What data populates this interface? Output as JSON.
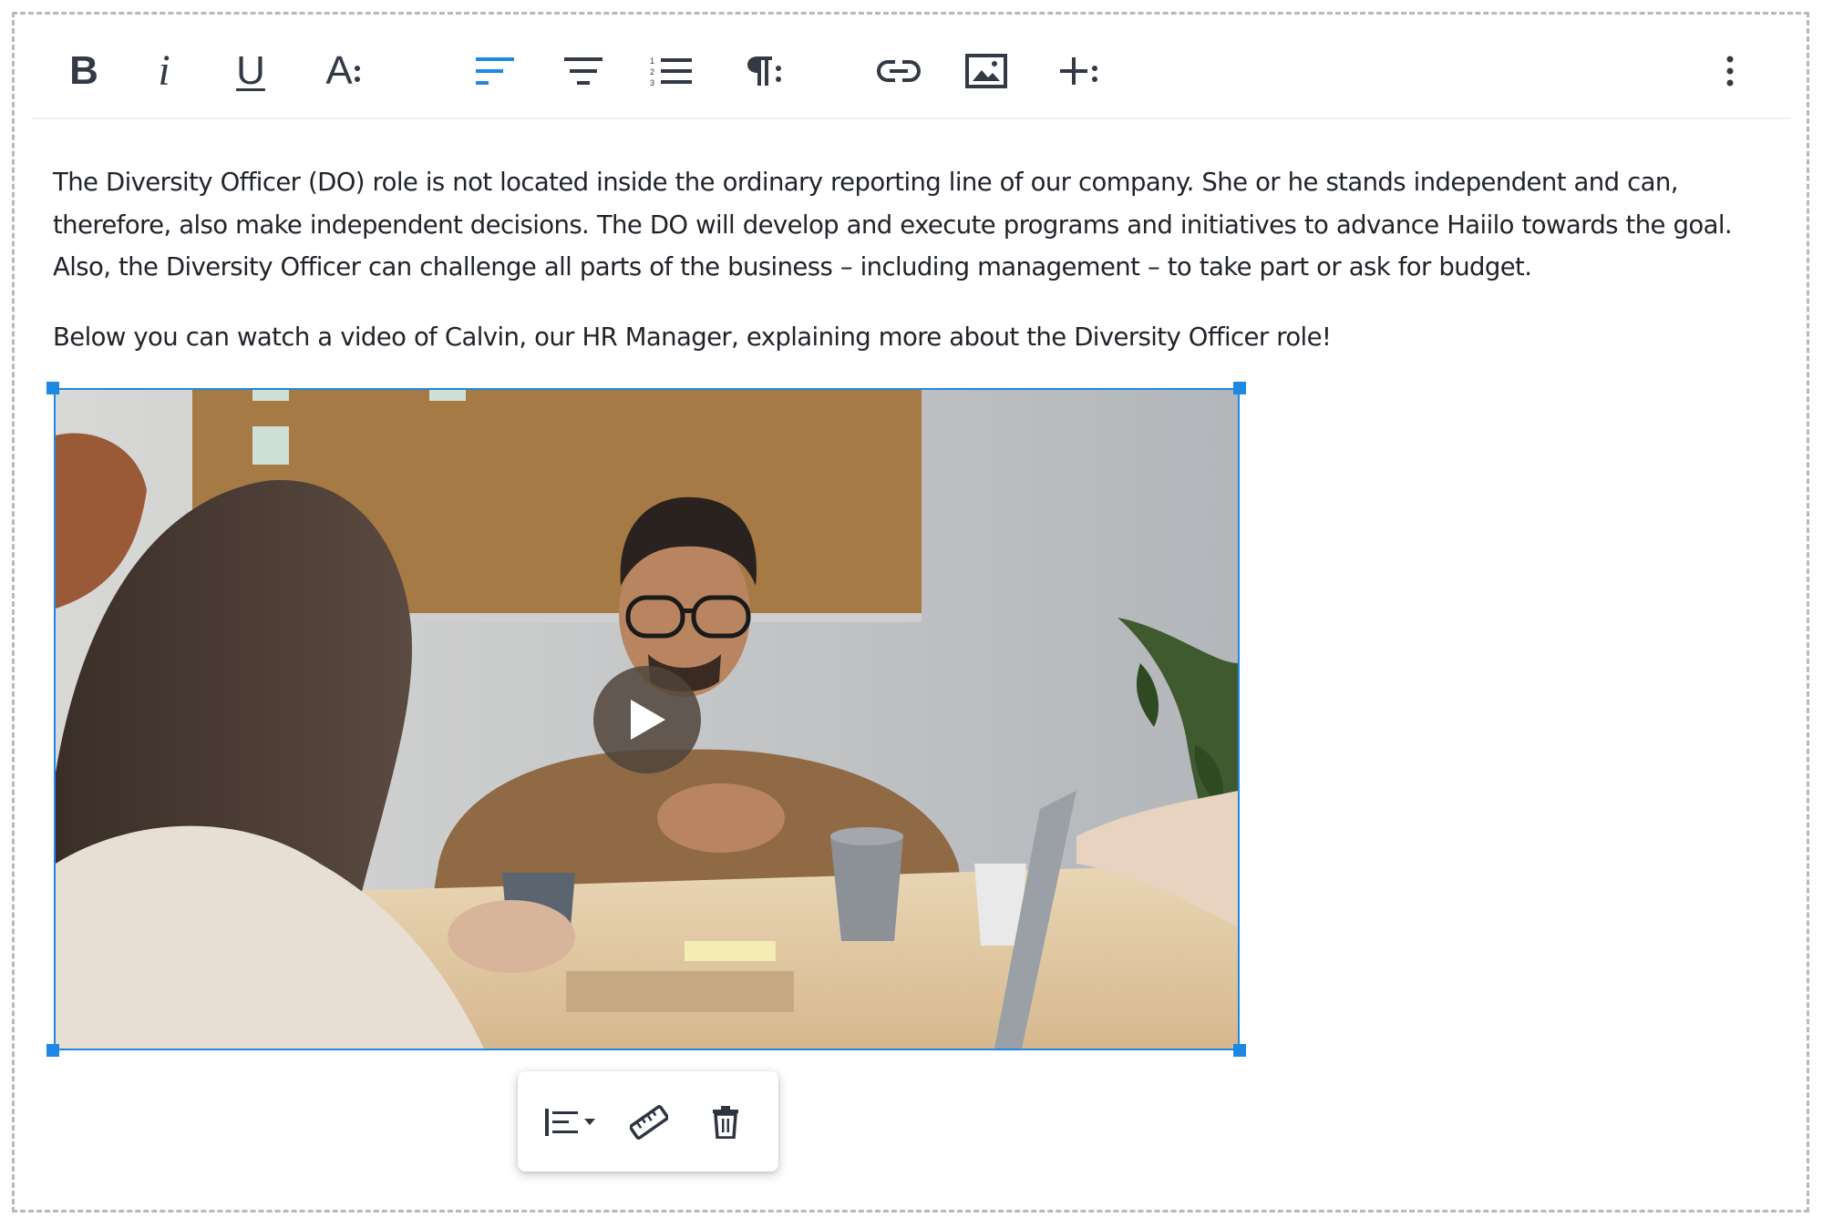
{
  "toolbar": {
    "bold_label": "B",
    "italic_label": "i",
    "underline_label": "U",
    "font_label": "A",
    "accent_color": "#1e88e5",
    "icon_color": "#2e3440",
    "icons": [
      "bold-icon",
      "italic-icon",
      "underline-icon",
      "font-options-icon",
      "align-left-icon",
      "align-center-icon",
      "ordered-list-icon",
      "paragraph-options-icon",
      "link-icon",
      "image-icon",
      "insert-more-icon",
      "more-options-icon"
    ]
  },
  "content": {
    "paragraph_1": "The Diversity Officer (DO) role is not located inside the ordinary reporting line of our company. She or he stands independent and can, therefore, also make independent decisions. The DO will develop and execute programs and initiatives to advance Haiilo towards the goal. Also, the Diversity Officer can challenge all parts of the business – including management – to take part or ask for budget.",
    "paragraph_2": "Below you can watch a video of Calvin, our HR Manager, explaining more about the Diversity Officer role!"
  },
  "video": {
    "selected": true,
    "selection_color": "#1e88e5",
    "play_icon": "play-icon"
  },
  "video_popup": {
    "icons": [
      "align-dropdown-icon",
      "ruler-icon",
      "trash-icon"
    ]
  }
}
